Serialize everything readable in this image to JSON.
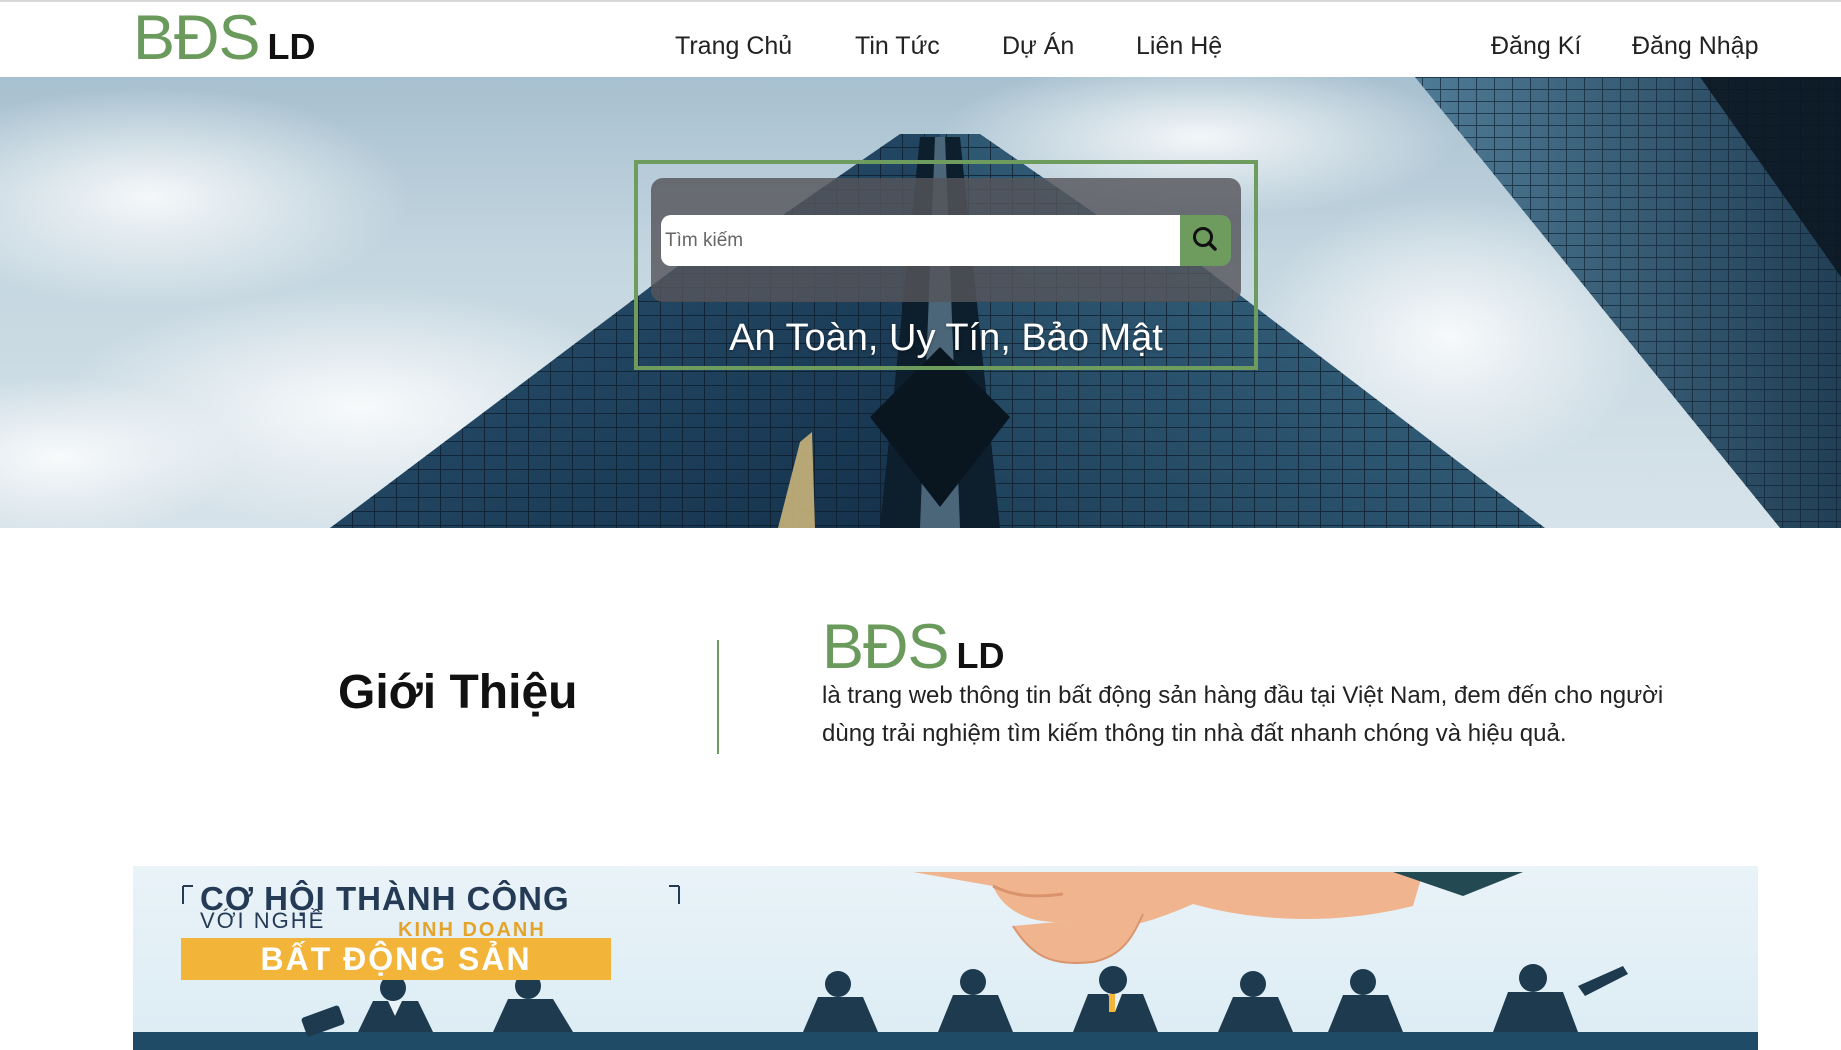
{
  "header": {
    "logo_main": "BĐS",
    "logo_sub": "LD",
    "nav": [
      {
        "label": "Trang Chủ"
      },
      {
        "label": "Tin Tức"
      },
      {
        "label": "Dự Án"
      },
      {
        "label": "Liên Hệ"
      }
    ],
    "register_label": "Đăng Kí",
    "login_label": "Đăng Nhập"
  },
  "hero": {
    "search_placeholder": "Tìm kiếm",
    "search_icon": "search-icon",
    "tagline": "An Toàn, Uy Tín, Bảo Mật"
  },
  "intro": {
    "title": "Giới Thiệu",
    "logo_main": "BĐS",
    "logo_sub": "LD",
    "text": "là trang web thông tin bất động sản hàng đầu tại Việt Nam, đem đến cho người dùng trải nghiệm tìm kiếm thông tin nhà đất nhanh chóng và hiệu quả."
  },
  "banner": {
    "title": "CƠ HỘI THÀNH CÔNG",
    "line1": "VỚI NGHỀ",
    "line2": "KINH DOANH",
    "badge": "BẤT ĐỘNG SẢN"
  },
  "colors": {
    "brand_green": "#6e9c5e",
    "logo_green": "#6a9a5c",
    "banner_yellow": "#f3b43a",
    "banner_navy": "#253b55"
  }
}
